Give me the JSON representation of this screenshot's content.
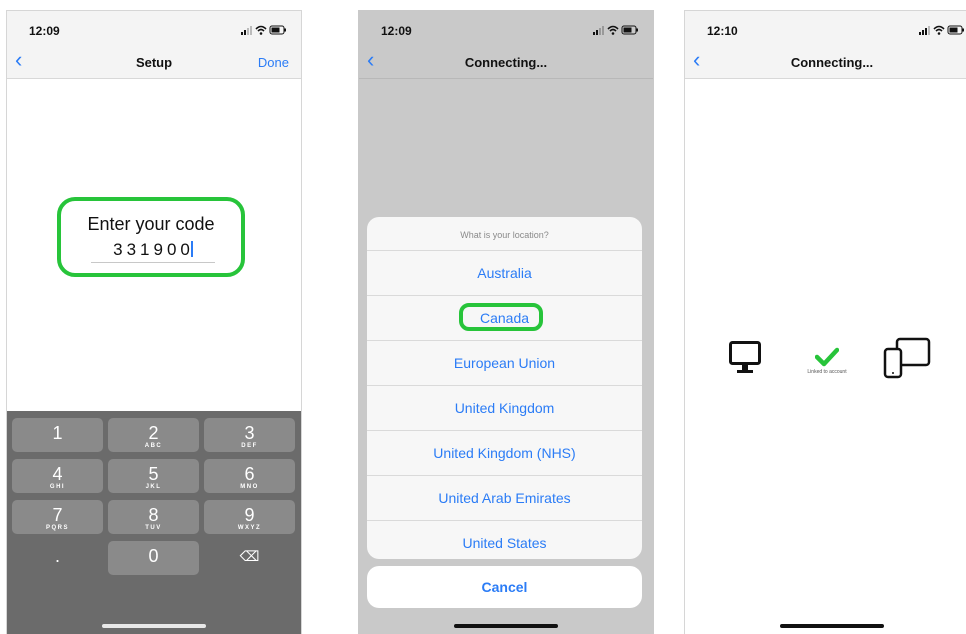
{
  "screens": [
    {
      "status": {
        "time": "12:09"
      },
      "nav": {
        "title": "Setup",
        "done": "Done"
      },
      "code": {
        "label": "Enter your code",
        "value": "331900"
      },
      "keypad": [
        {
          "digit": "1",
          "letters": ""
        },
        {
          "digit": "2",
          "letters": "ABC"
        },
        {
          "digit": "3",
          "letters": "DEF"
        },
        {
          "digit": "4",
          "letters": "GHI"
        },
        {
          "digit": "5",
          "letters": "JKL"
        },
        {
          "digit": "6",
          "letters": "MNO"
        },
        {
          "digit": "7",
          "letters": "PQRS"
        },
        {
          "digit": "8",
          "letters": "TUV"
        },
        {
          "digit": "9",
          "letters": "WXYZ"
        },
        {
          "digit": ".",
          "letters": ""
        },
        {
          "digit": "0",
          "letters": ""
        },
        {
          "digit": "⌫",
          "letters": ""
        }
      ]
    },
    {
      "status": {
        "time": "12:09"
      },
      "nav": {
        "title": "Connecting..."
      },
      "sheet": {
        "header": "What is your location?",
        "options": [
          "Australia",
          "Canada",
          "European Union",
          "United Kingdom",
          "United Kingdom (NHS)",
          "United Arab Emirates",
          "United States"
        ],
        "selected": "Canada",
        "cancel": "Cancel"
      }
    },
    {
      "status": {
        "time": "12:10"
      },
      "nav": {
        "title": "Connecting..."
      },
      "link": {
        "label": "Linked to account"
      }
    }
  ],
  "icons": [
    "back-chevron-icon",
    "signal-icon",
    "wifi-icon",
    "battery-icon",
    "monitor-icon",
    "checkmark-icon",
    "phone-tablet-icon",
    "delete-icon"
  ],
  "colors": {
    "accent": "#2b7cf6",
    "highlight": "#27c43a",
    "keypad_bg": "#6b6b6b",
    "key_bg": "#8a8a8a",
    "dim_bg": "#c9c9c9"
  }
}
